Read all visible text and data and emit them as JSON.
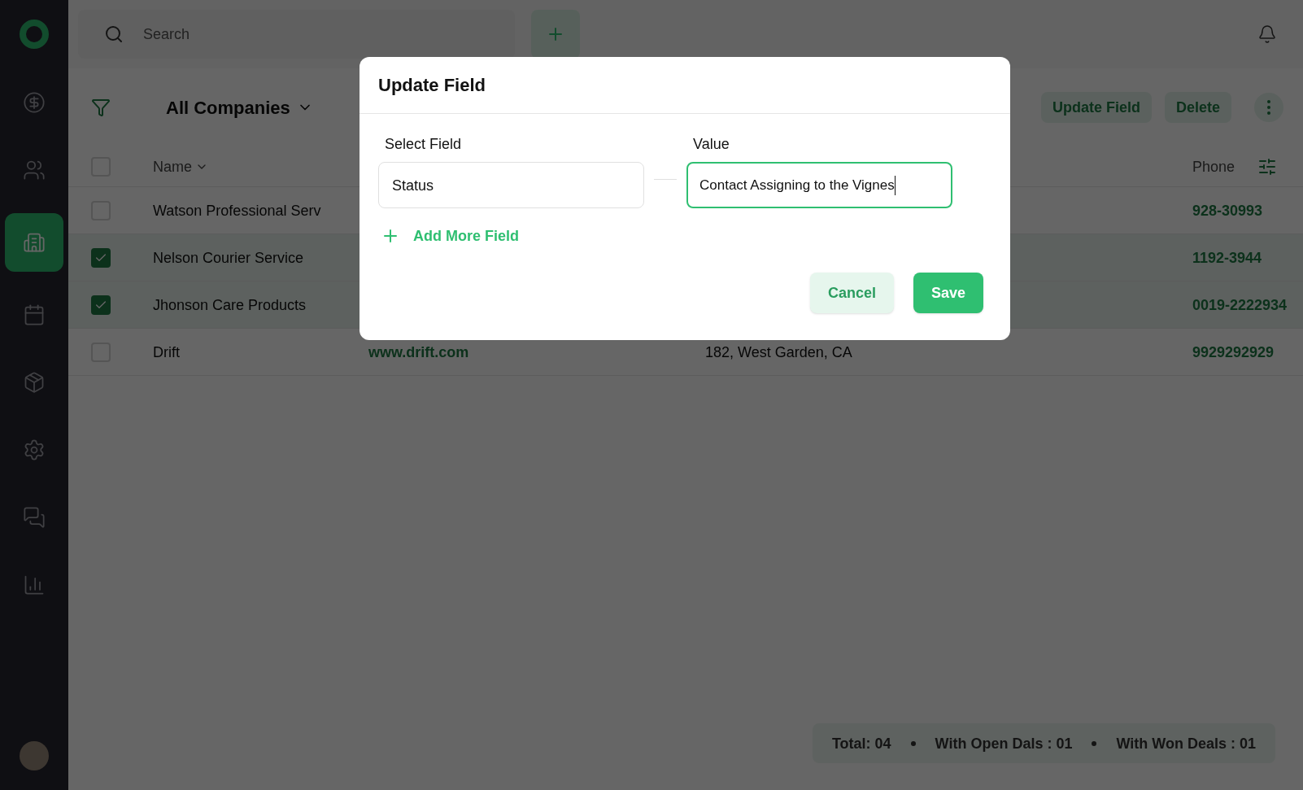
{
  "sidebar": {
    "items": [
      {
        "selected": false
      },
      {
        "selected": false
      },
      {
        "selected": true
      },
      {
        "selected": false
      },
      {
        "selected": false
      },
      {
        "selected": false
      },
      {
        "selected": false
      },
      {
        "selected": false
      }
    ]
  },
  "top_bar": {
    "search": {
      "placeholder": "Search"
    }
  },
  "toolbar": {
    "view": "All Companies",
    "actions": [
      "Update Field",
      "Delete"
    ]
  },
  "table": {
    "columns": [
      {
        "label": "Name"
      },
      {
        "label": "Phone"
      }
    ],
    "header_checked": false,
    "rows": [
      {
        "checked": false,
        "name": "Watson Professional Serv",
        "phone": "928-30993"
      },
      {
        "checked": true,
        "name": "Nelson Courier Service",
        "phone": "1192-3944"
      },
      {
        "checked": true,
        "name": "Jhonson Care Products",
        "phone": "0019-2222934"
      },
      {
        "checked": false,
        "name": "Drift",
        "website": "www.drift.com",
        "address": "182, West Garden, CA",
        "phone": "9929292929"
      }
    ]
  },
  "summary": [
    "Total: 04",
    "With Open Dals : 01",
    "With Won Deals : 01"
  ],
  "dialog": {
    "title": "Update Field",
    "fields": [
      {
        "label": "Select Field",
        "value": "Status",
        "focused": false
      },
      {
        "label": "Value",
        "value": "Contact Assigning to the Vignes",
        "focused": true
      }
    ],
    "add_more": "Add More Field",
    "buttons": [
      {
        "label": "Cancel",
        "kind": "secondary"
      },
      {
        "label": "Save",
        "kind": "primary"
      }
    ]
  }
}
